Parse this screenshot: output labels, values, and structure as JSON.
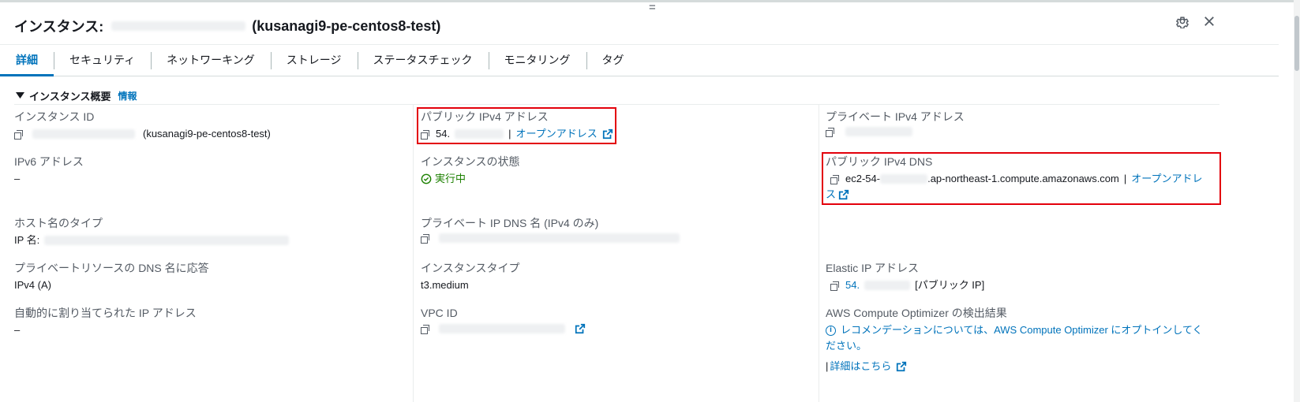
{
  "header": {
    "title_prefix": "インスタンス:",
    "title_suffix": "(kusanagi9-pe-centos8-test)",
    "drag_glyph": "="
  },
  "icons": {
    "settings": "gear-icon",
    "close": "close-icon",
    "copy": "copy-icon",
    "external": "external-link-icon"
  },
  "tabs": [
    {
      "label": "詳細",
      "active": true
    },
    {
      "label": "セキュリティ"
    },
    {
      "label": "ネットワーキング"
    },
    {
      "label": "ストレージ"
    },
    {
      "label": "ステータスチェック"
    },
    {
      "label": "モニタリング"
    },
    {
      "label": "タグ"
    }
  ],
  "section": {
    "title": "インスタンス概要",
    "info_link": "情報"
  },
  "fields": {
    "instance_id": {
      "label": "インスタンス ID",
      "suffix": "(kusanagi9-pe-centos8-test)"
    },
    "ipv6": {
      "label": "IPv6 アドレス",
      "value": "–"
    },
    "hostname_type": {
      "label": "ホスト名のタイプ",
      "prefix": "IP 名:"
    },
    "private_dns_answer": {
      "label": "プライベートリソースの DNS 名に応答",
      "value": "IPv4 (A)"
    },
    "auto_ip": {
      "label": "自動的に割り当てられた IP アドレス",
      "value": "–"
    },
    "public_ipv4": {
      "label": "パブリック IPv4 アドレス",
      "value": "54.",
      "separator": "|",
      "open_link": "オープンアドレス"
    },
    "instance_state": {
      "label": "インスタンスの状態",
      "value": "実行中"
    },
    "private_ip_dns": {
      "label": "プライベート IP DNS 名 (IPv4 のみ)"
    },
    "instance_type": {
      "label": "インスタンスタイプ",
      "value": "t3.medium"
    },
    "vpc_id": {
      "label": "VPC ID"
    },
    "private_ipv4": {
      "label": "プライベート IPv4 アドレス"
    },
    "public_dns": {
      "label": "パブリック IPv4 DNS",
      "prefix": "ec2-54-",
      "suffix": ".ap-northeast-1.compute.amazonaws.com",
      "separator": "|",
      "open_link_1": "オープンアドレ",
      "open_link_2": "ス"
    },
    "elastic_ip": {
      "label": "Elastic IP アドレス",
      "value": "54.",
      "tag": "[パブリック IP]"
    },
    "optimizer": {
      "label": "AWS Compute Optimizer の検出結果",
      "line1": "レコメンデーションについては、AWS Compute Optimizer にオプトインしてく",
      "line2": "ださい。",
      "separator": "|",
      "details_link": "詳細はこちら"
    }
  },
  "colors": {
    "link": "#0073bb",
    "success": "#1d8102",
    "highlight": "#e3000b"
  }
}
